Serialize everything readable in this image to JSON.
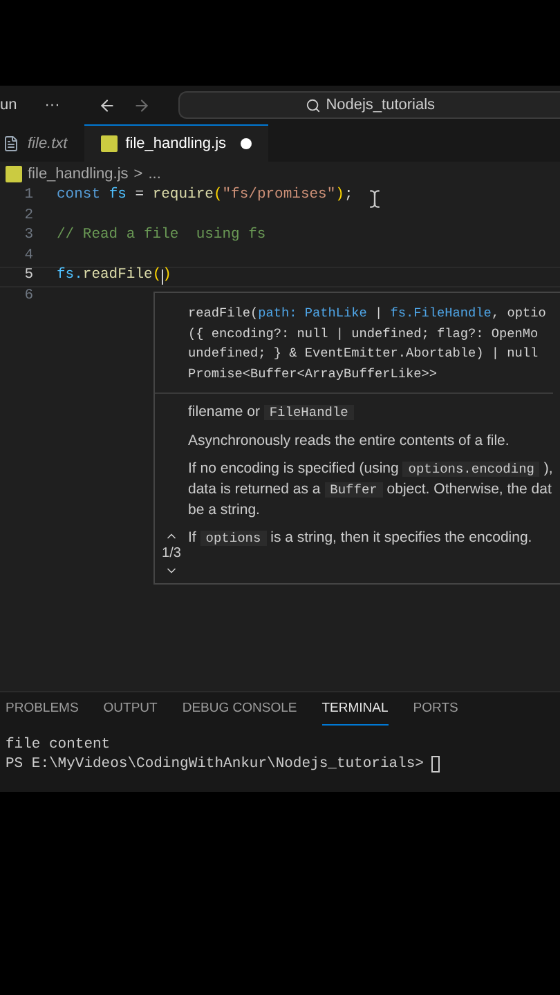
{
  "title_bar": {
    "menu_label": "un",
    "more": "···",
    "search": "Nodejs_tutorials"
  },
  "tabs": [
    {
      "label": "file.txt",
      "kind": "text",
      "selected": false,
      "modified": false,
      "preview": true
    },
    {
      "label": "file_handling.js",
      "kind": "js",
      "selected": true,
      "modified": true,
      "preview": false
    }
  ],
  "breadcrumb": {
    "file": "file_handling.js",
    "separator": ">",
    "rest": "..."
  },
  "editor": {
    "lines": [
      {
        "number": "1",
        "current": false,
        "tokens": [
          {
            "text": "const",
            "kind": "keyword"
          },
          {
            "text": " fs",
            "kind": "variable"
          },
          {
            "text": " = ",
            "kind": "plain"
          },
          {
            "text": "require",
            "kind": "function"
          },
          {
            "text": "(",
            "kind": "bracket"
          },
          {
            "text": "\"fs/promises\"",
            "kind": "string"
          },
          {
            "text": ")",
            "kind": "bracket"
          },
          {
            "text": ";",
            "kind": "plain"
          }
        ]
      },
      {
        "number": "2",
        "current": false
      },
      {
        "number": "3",
        "current": false,
        "tokens": [
          {
            "text": "// Read a file  using fs",
            "kind": "comment"
          }
        ]
      },
      {
        "number": "4",
        "current": false
      },
      {
        "number": "5",
        "current": true,
        "tokens": [
          {
            "text": "fs.",
            "kind": "variable"
          },
          {
            "text": "readFile",
            "kind": "function"
          },
          {
            "text": "(",
            "kind": "bracket",
            "caret": true
          },
          {
            "text": ")",
            "kind": "bracket"
          }
        ]
      },
      {
        "number": "6",
        "current": false
      }
    ]
  },
  "hover": {
    "signature": [
      [
        {
          "text": "readFile(",
          "kind": "plain"
        },
        {
          "text": "path: PathLike",
          "kind": "param"
        },
        {
          "text": " | ",
          "kind": "plain"
        },
        {
          "text": "fs.FileHandle",
          "kind": "param"
        },
        {
          "text": ", optio",
          "kind": "plain"
        }
      ],
      [
        {
          "text": "({ encoding?: null | undefined; flag?: OpenMo",
          "kind": "plain"
        }
      ],
      [
        {
          "text": "undefined; } & EventEmitter.Abortable) | null",
          "kind": "plain"
        }
      ],
      [
        {
          "text": "Promise<Buffer<ArrayBufferLike>>",
          "kind": "plain"
        }
      ]
    ],
    "docs": [
      [
        [
          {
            "text": "filename or ",
            "kind": "text"
          },
          {
            "text": "FileHandle",
            "kind": "code"
          }
        ]
      ],
      [
        [
          {
            "text": "Asynchronously reads the entire contents of a file.",
            "kind": "text"
          }
        ]
      ],
      [
        [
          {
            "text": "If no encoding is specified (using ",
            "kind": "text"
          },
          {
            "text": "options.encoding",
            "kind": "code"
          },
          {
            "text": " ),",
            "kind": "text"
          }
        ],
        [
          {
            "text": "data is returned as a ",
            "kind": "text"
          },
          {
            "text": "Buffer",
            "kind": "code"
          },
          {
            "text": " object. Otherwise, the dat",
            "kind": "text"
          }
        ],
        [
          {
            "text": "be a string.",
            "kind": "text"
          }
        ]
      ],
      [
        [
          {
            "text": "If ",
            "kind": "text"
          },
          {
            "text": "options",
            "kind": "code"
          },
          {
            "text": " is a string, then it specifies the encoding.",
            "kind": "text"
          }
        ]
      ]
    ],
    "overload": "1/3"
  },
  "panel": {
    "tabs": [
      {
        "label": "PROBLEMS",
        "selected": false
      },
      {
        "label": "OUTPUT",
        "selected": false
      },
      {
        "label": "DEBUG CONSOLE",
        "selected": false
      },
      {
        "label": "TERMINAL",
        "selected": true
      },
      {
        "label": "PORTS",
        "selected": false
      }
    ],
    "terminal": {
      "lines": [
        "file content",
        "PS E:\\MyVideos\\CodingWithAnkur\\Nodejs_tutorials>"
      ]
    }
  }
}
